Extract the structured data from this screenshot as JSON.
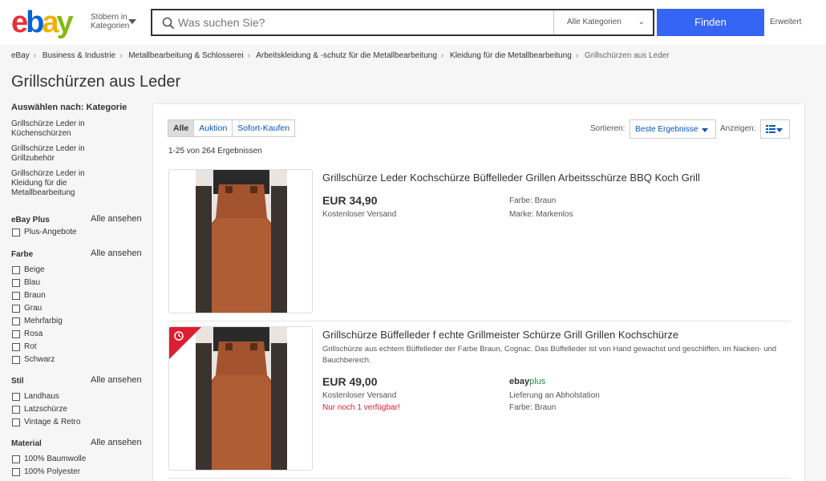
{
  "header": {
    "logo_letters": [
      {
        "char": "e",
        "color": "#e53238"
      },
      {
        "char": "b",
        "color": "#0064d2"
      },
      {
        "char": "a",
        "color": "#f5af02"
      },
      {
        "char": "y",
        "color": "#86b817"
      }
    ],
    "shop_by_label": "Stöbern in Kategorien",
    "search_placeholder": "Was suchen Sie?",
    "category_select": "Alle Kategorien",
    "find_button": "Finden",
    "advanced_link": "Erweitert",
    "accent_color": "#3665f3"
  },
  "breadcrumb": {
    "items": [
      "eBay",
      "Business & Industrie",
      "Metallbearbeitung & Schlosserei",
      "Arbeitskleidung & -schutz für die Metallbearbeitung",
      "Kleidung für die Metallbearbeitung"
    ],
    "current": "Grillschürzen aus Leder"
  },
  "page_title": "Grillschürzen aus Leder",
  "sidebar": {
    "category_heading": "Auswählen nach: Kategorie",
    "categories": [
      "Grillschürze Leder in Küchenschürzen",
      "Grillschürze Leder in Grillzubehör",
      "Grillschürze Leder in Kleidung für die Metallbearbeitung"
    ],
    "see_all": "Alle ansehen",
    "groups": [
      {
        "title": "eBay Plus",
        "options": [
          "Plus-Angebote"
        ]
      },
      {
        "title": "Farbe",
        "options": [
          "Beige",
          "Blau",
          "Braun",
          "Grau",
          "Mehrfarbig",
          "Rosa",
          "Rot",
          "Schwarz"
        ]
      },
      {
        "title": "Stil",
        "options": [
          "Landhaus",
          "Latzschürze",
          "Vintage & Retro"
        ]
      },
      {
        "title": "Material",
        "options": [
          "100% Baumwolle",
          "100% Polyester"
        ]
      }
    ]
  },
  "results": {
    "tabs": [
      "Alle",
      "Auktion",
      "Sofort-Kaufen"
    ],
    "active_tab": "Alle",
    "sort_label": "Sortieren:",
    "sort_value": "Beste Ergebnisse",
    "view_label": "Anzeigen:",
    "count_text": "1-25 von 264 Ergebnissen",
    "items": [
      {
        "title": "Grillschürze Leder Kochschürze Büffelleder Grillen Arbeitsschürze BBQ Koch Grill",
        "description": "",
        "price": "EUR 34,90",
        "shipping": "Kostenloser Versand",
        "availability": "",
        "attr_1": "Farbe: Braun",
        "attr_2": "Marke: Markenlos",
        "ebay_plus": false,
        "ribbon": false
      },
      {
        "title": "Grillschürze Büffelleder f echte Grillmeister Schürze Grill Grillen Kochschürze",
        "description": "Grillschürze aus echtem Büffelleder der Farbe Braun, Cognac. Das Büffelleder ist von Hand gewachst und geschliffen. im Nacken- und Bauchbereich.",
        "price": "EUR 49,00",
        "shipping": "Kostenloser Versand",
        "availability": "Nur noch 1 verfügbar!",
        "attr_1": "Lieferung an Abholstation",
        "attr_2": "Farbe: Braun",
        "ebay_plus": true,
        "ebay_plus_parts": [
          "ebay",
          "plus"
        ],
        "ribbon": true
      }
    ]
  }
}
